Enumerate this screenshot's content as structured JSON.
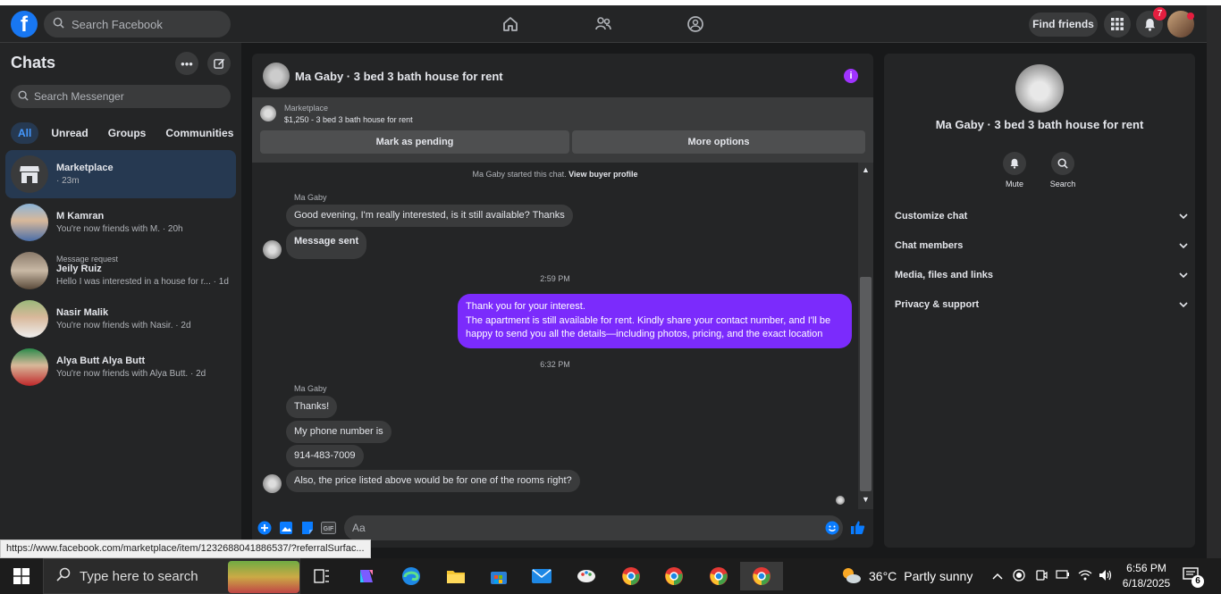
{
  "topnav": {
    "search_placeholder": "Search Facebook",
    "find_friends": "Find friends",
    "notification_count": "7"
  },
  "left": {
    "title": "Chats",
    "search_placeholder": "Search Messenger",
    "filters": [
      "All",
      "Unread",
      "Groups",
      "Communities"
    ],
    "chats": [
      {
        "pre": "",
        "name": "Marketplace",
        "sub": "· 23m"
      },
      {
        "pre": "",
        "name": "M Kamran",
        "sub": "You're now friends with M. · 20h"
      },
      {
        "pre": "Message request",
        "name": "Jeily Ruiz",
        "sub": "Hello I was interested in a house for r... · 1d"
      },
      {
        "pre": "",
        "name": "Nasir Malik",
        "sub": "You're now friends with Nasir. · 2d"
      },
      {
        "pre": "",
        "name": "Alya Butt Alya Butt",
        "sub": "You're now friends with Alya Butt. · 2d"
      }
    ]
  },
  "conversation": {
    "title": "Ma Gaby · 3 bed 3 bath house for rent",
    "marketplace_label": "Marketplace",
    "listing": "$1,250 - 3 bed 3 bath house for rent",
    "mark_pending": "Mark as pending",
    "more_options": "More options",
    "system_msg": "Ma Gaby started this chat.",
    "view_buyer": "View buyer profile",
    "sender_name": "Ma Gaby",
    "msg1": "Good evening, I'm really interested, is it still available? Thanks",
    "msg2": "Message sent",
    "time1": "2:59 PM",
    "out_line1": "Thank you for your interest.",
    "out_line2": "The apartment is still available for rent. Kindly share your contact number, and I'll be happy to send you all the details—including photos, pricing, and the exact location",
    "time2": "6:32 PM",
    "msg3": "Thanks!",
    "msg4": "My phone number is",
    "msg5": "914-483-7009",
    "msg6": "Also, the price listed above would be for one of the rooms right?",
    "composer_placeholder": "Aa"
  },
  "details": {
    "title": "Ma Gaby · 3 bed 3 bath house for rent",
    "mute": "Mute",
    "search": "Search",
    "sections": [
      "Customize chat",
      "Chat members",
      "Media, files and links",
      "Privacy & support"
    ]
  },
  "status_url": "https://www.facebook.com/marketplace/item/1232688041886537/?referralSurfac...",
  "taskbar": {
    "search_placeholder": "Type here to search",
    "temperature": "36°C",
    "weather": "Partly sunny",
    "time": "6:56 PM",
    "date": "6/18/2025",
    "notif_count": "6"
  },
  "colors": {
    "accent": "#7b2bfc",
    "brand": "#1877f2",
    "info": "#a033ff"
  }
}
